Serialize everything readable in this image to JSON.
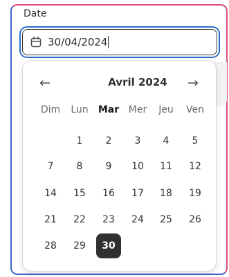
{
  "field": {
    "label": "Date",
    "value": "30/04/2024",
    "icon": "calendar-icon"
  },
  "calendar": {
    "month_title": "Avril 2024",
    "prev_icon": "arrow-left-icon",
    "next_icon": "arrow-right-icon",
    "prev_glyph": "←",
    "next_glyph": "→",
    "weekdays": [
      "Dim",
      "Lun",
      "Mar",
      "Mer",
      "Jeu",
      "Ven"
    ],
    "current_weekday_index": 2,
    "days": [
      [
        "",
        "1",
        "2",
        "3",
        "4",
        "5"
      ],
      [
        "7",
        "8",
        "9",
        "10",
        "11",
        "12"
      ],
      [
        "14",
        "15",
        "16",
        "17",
        "18",
        "19"
      ],
      [
        "21",
        "22",
        "23",
        "24",
        "25",
        "26"
      ],
      [
        "28",
        "29",
        "30",
        "",
        "",
        ""
      ]
    ],
    "selected_day": "30"
  },
  "colors": {
    "focus_ring": "#2c6ecb",
    "selected_day_bg": "#303030",
    "card_border_accent": "#d9507a"
  }
}
